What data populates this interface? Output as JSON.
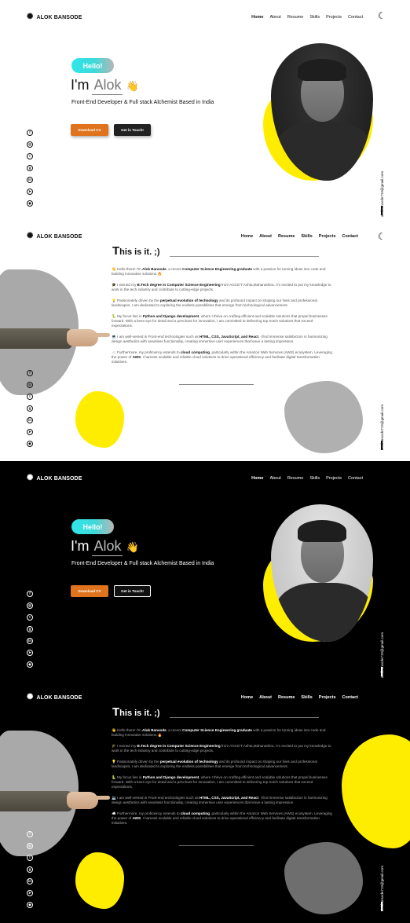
{
  "brand": {
    "name": "ALOK BANSODE",
    "icon": "react-atom-icon"
  },
  "nav": {
    "items": [
      "Home",
      "About",
      "Resume",
      "Skills",
      "Projects",
      "Contact"
    ],
    "active": "Home"
  },
  "theme_toggle": {
    "icon": "moon-icon"
  },
  "hero": {
    "hello": "Hello!",
    "im": "I'm",
    "name": "Alok",
    "wave": "👋",
    "tagline": "Front-End Developer & Full stack Alchemist Based in India",
    "download_cv": "Download CV",
    "get_in_touch": "Get in Touch!"
  },
  "socials": [
    {
      "icon": "facebook-icon",
      "glyph": "f"
    },
    {
      "icon": "instagram-icon",
      "glyph": "◎"
    },
    {
      "icon": "twitter-icon",
      "glyph": "t"
    },
    {
      "icon": "github-icon",
      "glyph": "g"
    },
    {
      "icon": "linkedin-icon",
      "glyph": "in"
    },
    {
      "icon": "telegram-icon",
      "glyph": "➤"
    },
    {
      "icon": "snapchat-icon",
      "glyph": "◆"
    }
  ],
  "email": "alokbansode719@gmail.com",
  "about": {
    "title_big": "T",
    "title_rest": "his is it. ;)",
    "p1": {
      "emoji": "👋",
      "pre": " Hello there! I'm ",
      "b1": "Alok Bansode",
      "mid": ", a recent ",
      "b2": "Computer Science Engineering graduate",
      "post": " with a passion for turning ideas into code and building innovative solutions.🔥"
    },
    "p2": {
      "emoji": "🎓",
      "pre": " I earned my ",
      "b1": "B.Tech degree in Computer Science Engineering",
      "post": " from AGCE'T Ashta,Maharashtra. I'm excited to put my knowledge to work in the tech industry and contribute to cutting-edge projects."
    },
    "p3": {
      "emoji": "💡",
      "pre": " Passionately driven by the ",
      "b1": "perpetual evolution of technology",
      "post": " and its profound impact on shaping our lives and professional landscapes, I am dedicated to exploring the endless possibilities that emerge from technological advancement."
    },
    "p4": {
      "emoji": "🐍",
      "pre": " My focus lies in ",
      "b1": "Python and Django development",
      "post": ", where I thrive on crafting efficient and scalable solutions that propel businesses forward. With a keen eye for detail and a penchant for innovation, I am committed to delivering top-notch solutions that exceed expectations."
    },
    "p5": {
      "emoji": "💻",
      "pre": " I am well-versed in Front-end technologies such as ",
      "b1": "HTML, CSS, JavaScript, and React",
      "post": ". I find immense satisfaction in harmonizing design aesthetics with seamless functionality, creating immersive user experiences that leave a lasting impression."
    },
    "p6": {
      "emoji": "☁️",
      "pre": " Furthermore, my proficiency extends to ",
      "b1": "cloud computing",
      "mid": ", particularly within the Amazon Web Services (AWS) ecosystem. Leveraging the power of ",
      "b2": "AWS",
      "post": ", I harness scalable and reliable cloud solutions to drive operational efficiency and facilitate digital transformation initiatives."
    }
  },
  "colors": {
    "accent_yellow": "#ffed00",
    "cv_orange": "#e0731d",
    "hello_cyan": "#2ee6ea",
    "blob_grey": "#a9a9a9"
  }
}
